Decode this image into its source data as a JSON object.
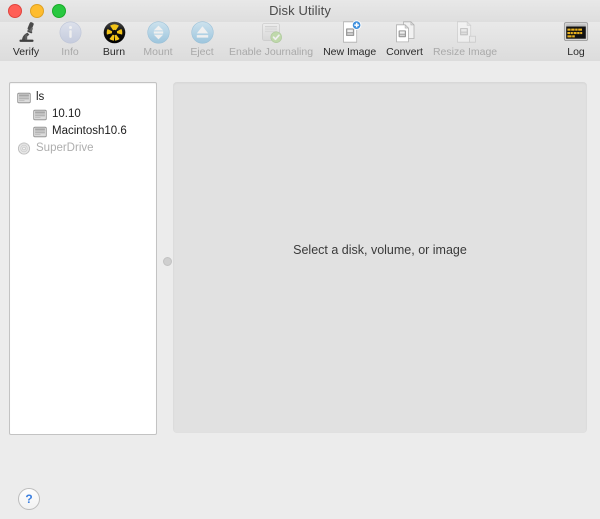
{
  "window": {
    "title": "Disk Utility",
    "traffic_lights": [
      {
        "name": "close",
        "color": "#ff5f57"
      },
      {
        "name": "minimize",
        "color": "#febc2e"
      },
      {
        "name": "maximize",
        "color": "#28c840"
      }
    ]
  },
  "toolbar": {
    "items": [
      {
        "label": "Verify",
        "icon": "microscope-icon",
        "enabled": true
      },
      {
        "label": "Info",
        "icon": "info-circle-icon",
        "enabled": false
      },
      {
        "label": "Burn",
        "icon": "radiation-icon",
        "enabled": true
      },
      {
        "label": "Mount",
        "icon": "mount-arrows-icon",
        "enabled": false
      },
      {
        "label": "Eject",
        "icon": "eject-icon",
        "enabled": false
      },
      {
        "label": "Enable Journaling",
        "icon": "disk-check-icon",
        "enabled": false
      },
      {
        "label": "New Image",
        "icon": "document-plus-icon",
        "enabled": true
      },
      {
        "label": "Convert",
        "icon": "documents-icon",
        "enabled": true
      },
      {
        "label": "Resize Image",
        "icon": "document-resize-icon",
        "enabled": false
      }
    ],
    "log": {
      "label": "Log",
      "icon": "console-log-icon",
      "screen_text_line1": "WARNI",
      "screen_text_line2": "AY 7:34"
    }
  },
  "sidebar": {
    "items": [
      {
        "label": "ls",
        "icon": "hard-disk-icon",
        "level": 0,
        "enabled": true
      },
      {
        "label": "10.10",
        "icon": "volume-icon",
        "level": 1,
        "enabled": true
      },
      {
        "label": "Macintosh10.6",
        "icon": "volume-icon",
        "level": 1,
        "enabled": true
      },
      {
        "label": "SuperDrive",
        "icon": "optical-disc-icon",
        "level": 0,
        "enabled": false
      }
    ]
  },
  "main": {
    "empty_message": "Select a disk, volume, or image"
  },
  "footer": {
    "help_label": "?"
  },
  "colors": {
    "window_background": "#ececec",
    "toolbar_top": "#e9e9e9",
    "toolbar_bottom": "#dcdcdc",
    "sidebar_background": "#ffffff",
    "main_panel_background": "#e1e1e1",
    "accent_blue": "#3b7fe0",
    "disabled_text": "#a9a9a9",
    "log_screen_amber": "#e8b11e"
  }
}
